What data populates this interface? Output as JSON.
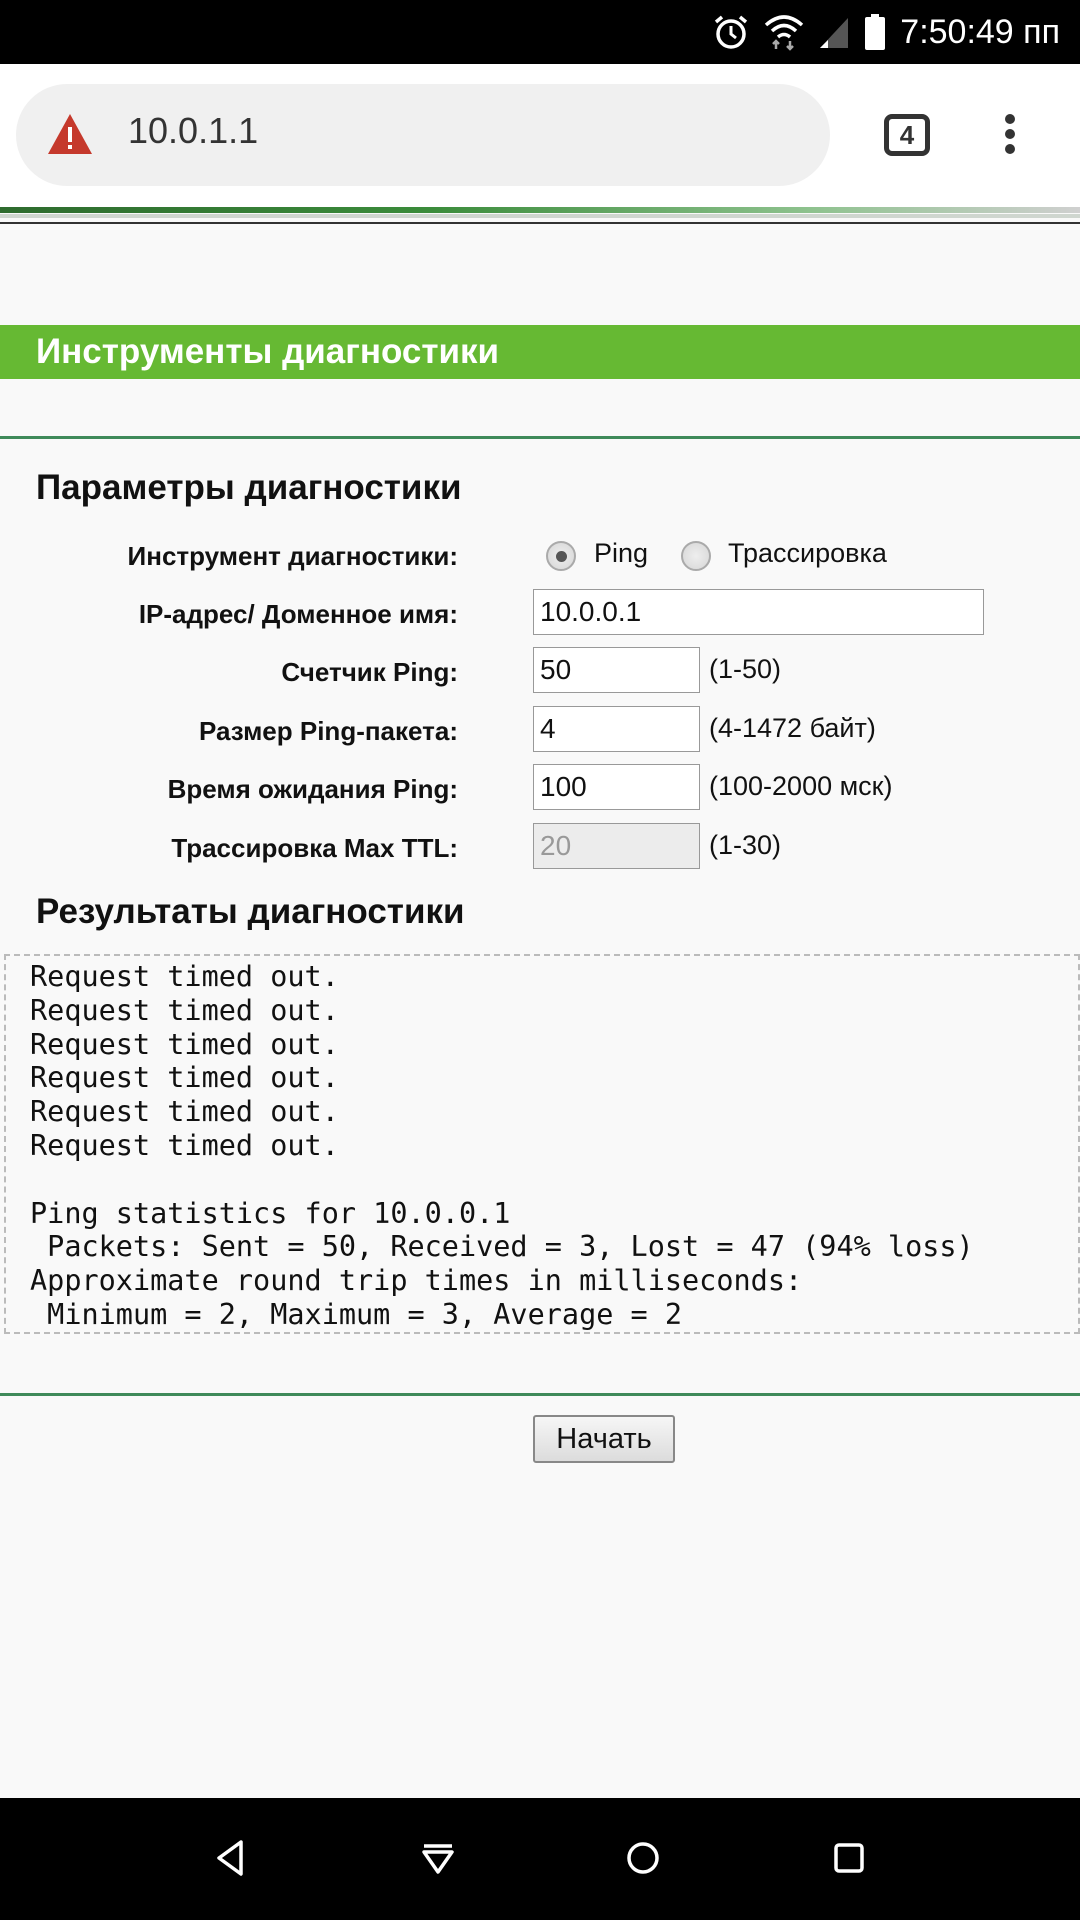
{
  "status_bar": {
    "time": "7:50:49 пп",
    "icons": [
      "alarm-icon",
      "wifi-icon",
      "signal-icon",
      "battery-icon"
    ]
  },
  "browser": {
    "url": "10.0.1.1",
    "tab_count": "4",
    "security_icon": "warning-triangle-icon",
    "menu_icon": "more-vert-icon"
  },
  "page": {
    "section_title": "Инструменты диагностики",
    "params_title": "Параметры диагностики",
    "results_title": "Результаты диагностики",
    "fields": {
      "tool_label": "Инструмент диагностики:",
      "tool_options": [
        "Ping",
        "Трассировка"
      ],
      "tool_selected": "Ping",
      "ip_label": "IP-адрес/ Доменное имя:",
      "ip_value": "10.0.0.1",
      "count_label": "Счетчик Ping:",
      "count_value": "50",
      "count_hint": "(1-50)",
      "size_label": "Размер Ping-пакета:",
      "size_value": "4",
      "size_hint": "(4-1472 байт)",
      "timeout_label": "Время ожидания Ping:",
      "timeout_value": "100",
      "timeout_hint": "(100-2000 мск)",
      "ttl_label": "Трассировка Max TTL:",
      "ttl_value": "20",
      "ttl_hint": "(1-30)"
    },
    "results_text": "Request timed out.\nRequest timed out.\nRequest timed out.\nRequest timed out.\nRequest timed out.\nRequest timed out.\n\nPing statistics for 10.0.0.1\n Packets: Sent = 50, Received = 3, Lost = 47 (94% loss)\nApproximate round trip times in milliseconds:\n Minimum = 2, Maximum = 3, Average = 2",
    "start_button": "Начать"
  },
  "colors": {
    "section_bar": "#66b933",
    "divider": "#3f8a5a",
    "page_background": "#f9f9f9"
  },
  "nav_bar": {
    "icons": [
      "back-icon",
      "home-icon",
      "recents-icon",
      "notifications-icon"
    ]
  }
}
